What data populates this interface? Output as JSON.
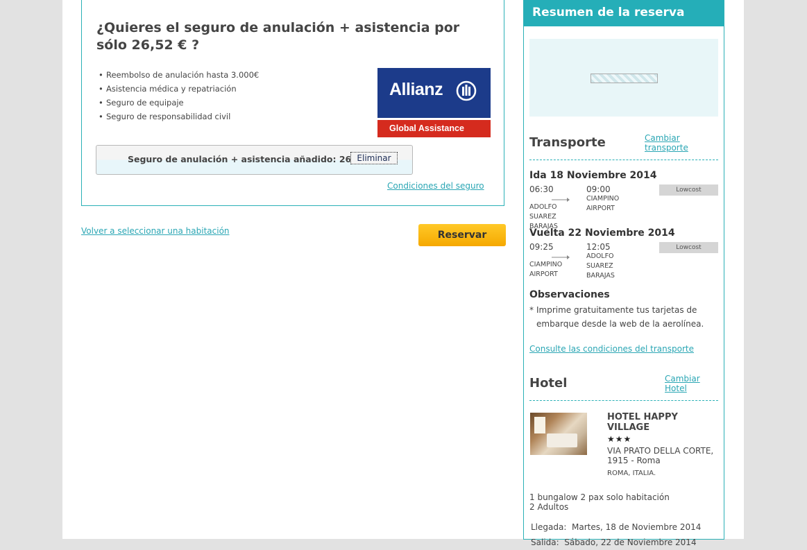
{
  "insurance": {
    "title": "¿Quieres el seguro de anulación + asistencia por sólo 26,52 € ?",
    "bullet_char": "•",
    "benefits": [
      "Reembolso de anulación hasta 3.000€",
      "Asistencia médica y repatriación",
      "Seguro de equipaje",
      "Seguro de responsabilidad civil"
    ],
    "logo_name": "Allianz",
    "logo_subtitle": "Global Assistance",
    "added_text": "Seguro de anulación + asistencia añadido: 26,52 €",
    "remove_label": "Eliminar",
    "conditions_link": "Condiciones del seguro"
  },
  "actions": {
    "back_link": "Volver a seleccionar una habitación",
    "reserve_label": "Reservar",
    "reserve_color": "#f5a800"
  },
  "sidebar": {
    "title": "Resumen de la reserva",
    "accent_color": "#25aeb8",
    "transport": {
      "title": "Transporte",
      "change_link": "Cambiar transporte",
      "legs": [
        {
          "label": "Ida",
          "date": "18 Noviembre 2014",
          "dep_time": "06:30",
          "arr_time": "09:00",
          "dep_airport": "ADOLFO SUAREZ BARAJAS",
          "arr_airport": "CIAMPINO AIRPORT",
          "fare": "Lowcost"
        },
        {
          "label": "Vuelta",
          "date": "22 Noviembre 2014",
          "dep_time": "09:25",
          "arr_time": "12:05",
          "dep_airport": "CIAMPINO AIRPORT",
          "arr_airport": "ADOLFO SUAREZ BARAJAS",
          "fare": "Lowcost"
        }
      ],
      "observations_title": "Observaciones",
      "observations_star": "*",
      "observations_line1": "Imprime gratuitamente tus tarjetas de",
      "observations_line2": "embarque desde la web de la aerolínea.",
      "conditions_link": "Consulte las condiciones del transporte"
    },
    "hotel": {
      "title": "Hotel",
      "change_link": "Cambiar Hotel",
      "name": "HOTEL HAPPY VILLAGE",
      "stars": "★★★",
      "address": "VIA PRATO DELLA CORTE, 1915 - Roma",
      "country": "ROMA, ITALIA.",
      "room_line1": "1 bungalow 2 pax solo habitación",
      "room_line2": "2 Adultos",
      "arrival_label": "Llegada:",
      "arrival_value": "Martes, 18 de Noviembre 2014",
      "departure_label": "Salida:",
      "departure_value": "Sábado, 22 de Noviembre 2014"
    }
  }
}
